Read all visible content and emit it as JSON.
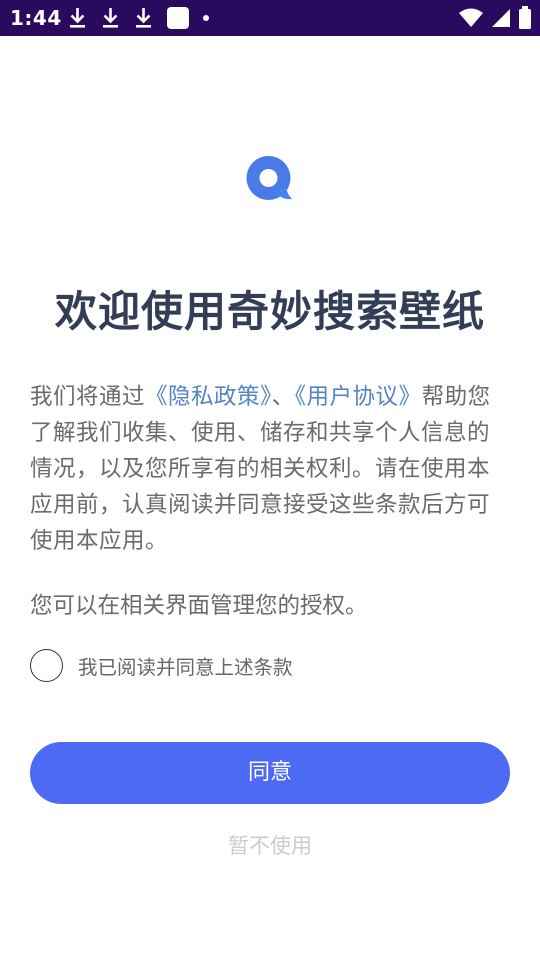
{
  "status_bar": {
    "time": "1:44",
    "left_icons": [
      "download-icon",
      "download-icon",
      "download-icon",
      "square-notification-icon",
      "dot-icon"
    ],
    "right_icons": [
      "wifi-icon",
      "cell-signal-icon",
      "battery-icon"
    ]
  },
  "app": {
    "icon": "search-bubble-logo-icon",
    "brand_color": "#4a7ae6"
  },
  "title": "欢迎使用奇妙搜索壁纸",
  "consent": {
    "intro_before": "我们将通过",
    "privacy_link": "《隐私政策》",
    "separator": "、",
    "agreement_link": "《用户协议》",
    "intro_after": "帮助您了解我们收集、使用、储存和共享个人信息的情况，以及您所享有的相关权利。请在使用本应用前，认真阅读并同意接受这些条款后方可使用本应用。",
    "auth_note": "您可以在相关界面管理您的授权。",
    "checkbox_label": "我已阅读并同意上述条款",
    "checkbox_checked": false
  },
  "buttons": {
    "agree": "同意",
    "decline": "暂不使用"
  },
  "colors": {
    "status_bar": "#2a0a5e",
    "primary_button": "#4d6af5",
    "link": "#5384c4",
    "title": "#333d56"
  }
}
